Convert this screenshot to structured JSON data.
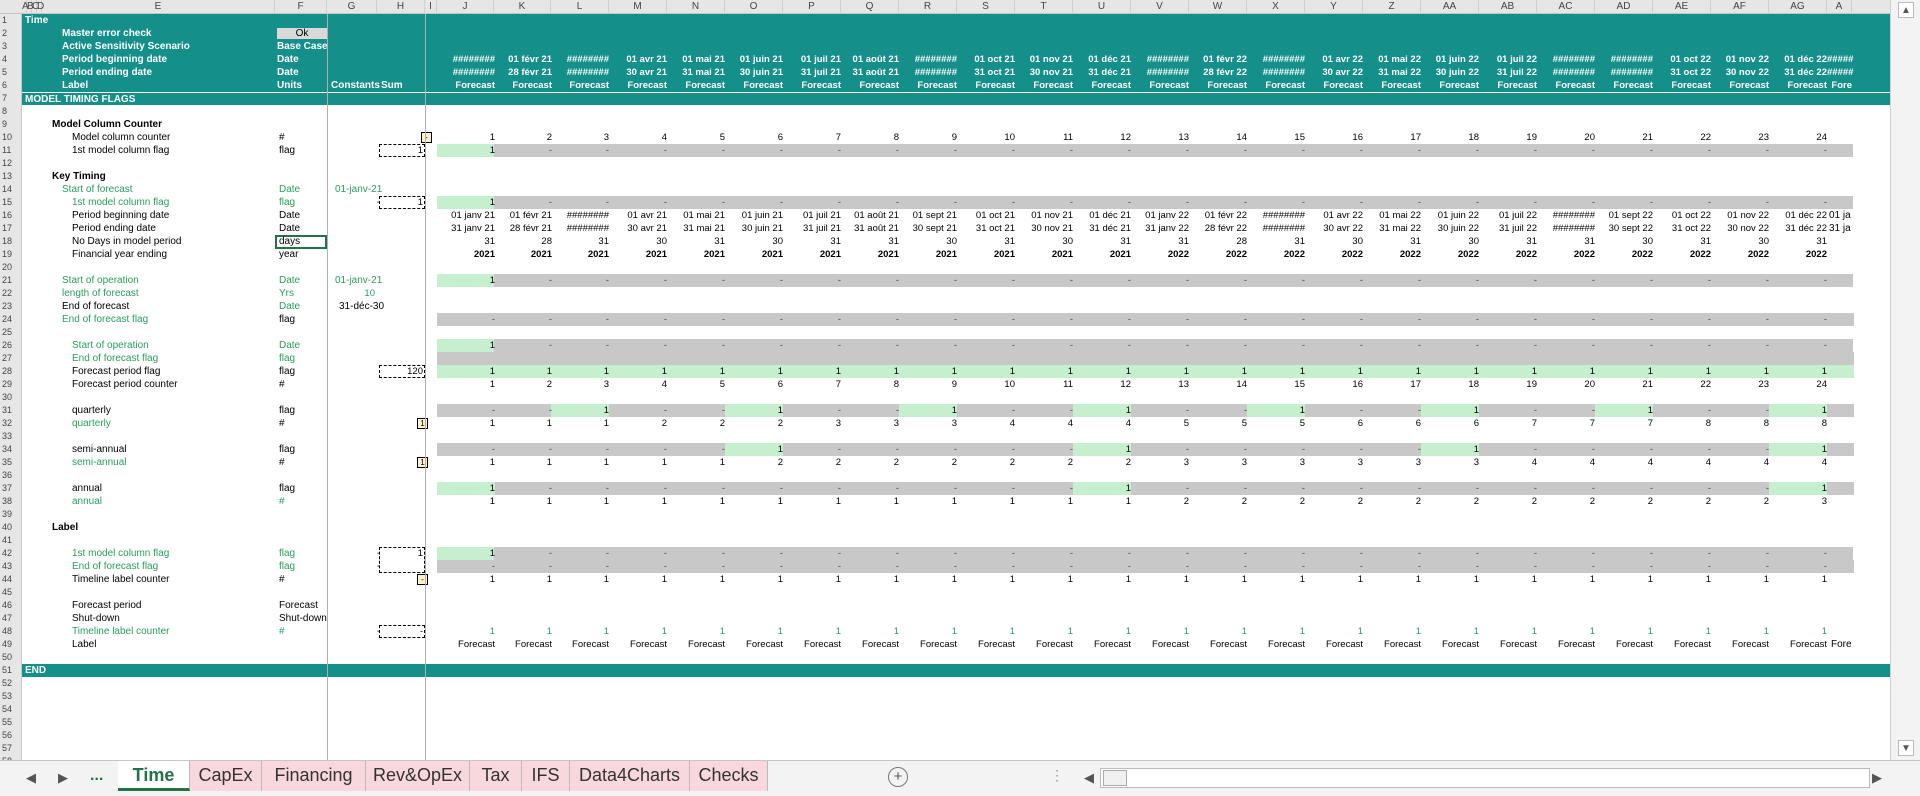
{
  "columns": [
    "A",
    "B",
    "C",
    "D",
    "E",
    "F",
    "G",
    "H",
    "I",
    "J",
    "K",
    "L",
    "M",
    "N",
    "O",
    "P",
    "Q",
    "R",
    "S",
    "T",
    "U",
    "V",
    "W",
    "X",
    "Y",
    "Z",
    "AA",
    "AB",
    "AC",
    "AD",
    "AE",
    "AF",
    "AG",
    "A"
  ],
  "sheet_title": "Time",
  "header_rows": {
    "master_error_check": {
      "label": "Master error check",
      "value": "Ok"
    },
    "scenario": {
      "label": "Active Sensitivity Scenario",
      "value": "Base Case"
    },
    "period_begin": {
      "label": "Period beginning date",
      "unit": "Date",
      "values": [
        "########",
        "01 févr 21",
        "########",
        "01 avr 21",
        "01 mai 21",
        "01 juin 21",
        "01 juil 21",
        "01 août 21",
        "########",
        "01 oct 21",
        "01 nov 21",
        "01 déc 21",
        "########",
        "01 févr 22",
        "########",
        "01 avr 22",
        "01 mai 22",
        "01 juin 22",
        "01 juil 22",
        "########",
        "########",
        "01 oct 22",
        "01 nov 22",
        "01 déc 22",
        "#####"
      ]
    },
    "period_end": {
      "label": "Period ending date",
      "unit": "Date",
      "values": [
        "########",
        "28 févr 21",
        "########",
        "30 avr 21",
        "31 mai 21",
        "30 juin 21",
        "31 juil 21",
        "31 août 21",
        "########",
        "31 oct 21",
        "30 nov 21",
        "31 déc 21",
        "########",
        "28 févr 22",
        "########",
        "30 avr 22",
        "31 mai 22",
        "30 juin 22",
        "31 juil 22",
        "########",
        "########",
        "31 oct 22",
        "30 nov 22",
        "31 déc 22",
        "#####"
      ]
    },
    "label_row": {
      "label": "Label",
      "unit": "Units",
      "constants": "Constants",
      "sum": "Sum",
      "value": "Forecast",
      "last": "Fore"
    }
  },
  "section_title": "MODEL TIMING FLAGS",
  "end_label": "END",
  "groups": {
    "model_col_counter": "Model Column Counter",
    "key_timing": "Key Timing",
    "label": "Label"
  },
  "labels": {
    "model_column_counter": "Model column counter",
    "first_model_column_flag": "1st model column flag",
    "start_of_forecast": "Start of forecast",
    "period_beginning_date": "Period beginning date",
    "period_ending_date": "Period ending date",
    "no_days": "No Days in model period",
    "fy_ending": "Financial year ending",
    "start_of_operation": "Start of operation",
    "length_of_forecast": "length of forecast",
    "end_of_forecast": "End of forecast",
    "end_of_forecast_flag": "End of forecast flag",
    "forecast_period_flag": "Forecast period flag",
    "forecast_period_counter": "Forecast period counter",
    "quarterly": "quarterly",
    "semi_annual": "semi-annual",
    "annual": "annual",
    "timeline_label_counter": "Timeline label counter",
    "forecast_period": "Forecast period",
    "shut_down": "Shut-down",
    "label": "Label"
  },
  "units": {
    "hash": "#",
    "flag": "flag",
    "date": "Date",
    "days": "days",
    "year": "year",
    "yrs": "Yrs",
    "forecast": "Forecast",
    "shutdown": "Shut-down"
  },
  "constants": {
    "start_of_forecast": "01-janv-21",
    "start_of_operation": "01-janv-21",
    "length_of_forecast": "10",
    "end_of_forecast": "31-déc-30"
  },
  "sums": {
    "first_flag": "1",
    "first_flag2": "1",
    "forecast_period_flag": "120",
    "label_first_flag": "1",
    "timeline_label": "-"
  },
  "dash": "-",
  "one": "1",
  "counter": [
    "1",
    "2",
    "3",
    "4",
    "5",
    "6",
    "7",
    "8",
    "9",
    "10",
    "11",
    "12",
    "13",
    "14",
    "15",
    "16",
    "17",
    "18",
    "19",
    "20",
    "21",
    "22",
    "23",
    "24"
  ],
  "pb_dates": [
    "01 janv 21",
    "01 févr 21",
    "########",
    "01 avr 21",
    "01 mai 21",
    "01 juin 21",
    "01 juil 21",
    "01 août 21",
    "01 sept 21",
    "01 oct 21",
    "01 nov 21",
    "01 déc 21",
    "01 janv 22",
    "01 févr 22",
    "########",
    "01 avr 22",
    "01 mai 22",
    "01 juin 22",
    "01 juil 22",
    "########",
    "01 sept 22",
    "01 oct 22",
    "01 nov 22",
    "01 déc 22"
  ],
  "pe_dates": [
    "31 janv 21",
    "28 févr 21",
    "########",
    "30 avr 21",
    "31 mai 21",
    "30 juin 21",
    "31 juil 21",
    "31 août 21",
    "30 sept 21",
    "31 oct 21",
    "30 nov 21",
    "31 déc 21",
    "31 janv 22",
    "28 févr 22",
    "########",
    "30 avr 22",
    "31 mai 22",
    "30 juin 22",
    "31 juil 22",
    "########",
    "30 sept 22",
    "31 oct 22",
    "30 nov 22",
    "31 déc 22"
  ],
  "days": [
    "31",
    "28",
    "31",
    "30",
    "31",
    "30",
    "31",
    "31",
    "30",
    "31",
    "30",
    "31",
    "31",
    "28",
    "31",
    "30",
    "31",
    "30",
    "31",
    "31",
    "30",
    "31",
    "30",
    "31"
  ],
  "fy": [
    "2021",
    "2021",
    "2021",
    "2021",
    "2021",
    "2021",
    "2021",
    "2021",
    "2021",
    "2021",
    "2021",
    "2021",
    "2022",
    "2022",
    "2022",
    "2022",
    "2022",
    "2022",
    "2022",
    "2022",
    "2022",
    "2022",
    "2022",
    "2022"
  ],
  "quarter_no": [
    "1",
    "1",
    "1",
    "2",
    "2",
    "2",
    "3",
    "3",
    "3",
    "4",
    "4",
    "4",
    "5",
    "5",
    "5",
    "6",
    "6",
    "6",
    "7",
    "7",
    "7",
    "8",
    "8",
    "8"
  ],
  "semi_no": [
    "1",
    "1",
    "1",
    "1",
    "1",
    "2",
    "2",
    "2",
    "2",
    "2",
    "2",
    "2",
    "3",
    "3",
    "3",
    "3",
    "3",
    "3",
    "4",
    "4",
    "4",
    "4",
    "4",
    "4"
  ],
  "annual_no": [
    "1",
    "1",
    "1",
    "1",
    "1",
    "1",
    "1",
    "1",
    "1",
    "1",
    "1",
    "1",
    "2",
    "2",
    "2",
    "2",
    "2",
    "2",
    "2",
    "2",
    "2",
    "2",
    "2",
    "3"
  ],
  "overflow": {
    "pb": "01 ja",
    "pe": "31 ja"
  },
  "tabs": [
    "Time",
    "CapEx",
    "Financing",
    "Rev&OpEx",
    "Tax",
    "IFS",
    "Data4Charts",
    "Checks"
  ],
  "tab_more": "...",
  "add_sheet": "+"
}
